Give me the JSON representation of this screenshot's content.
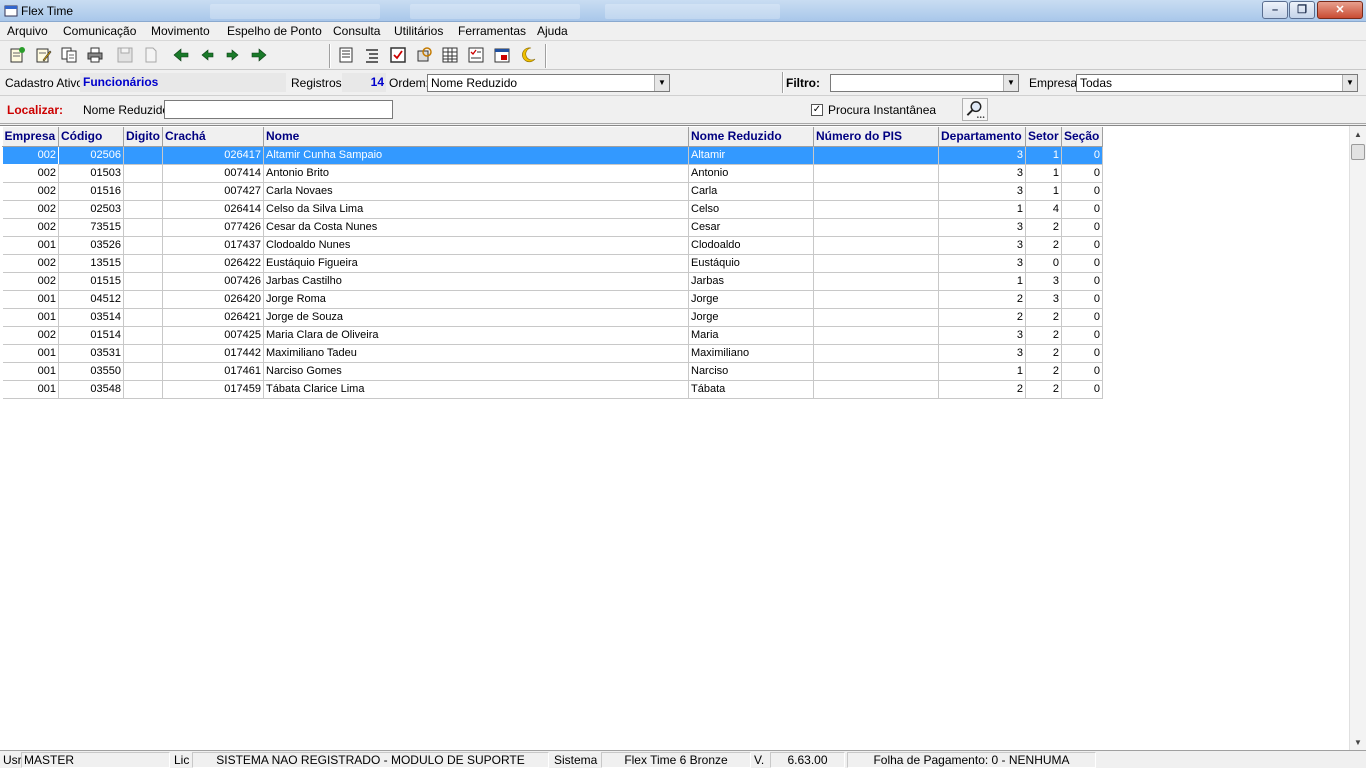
{
  "window": {
    "title": "Flex Time"
  },
  "menu": [
    "Arquivo",
    "Comunicação",
    "Movimento",
    "Espelho de Ponto",
    "Consulta",
    "Utilitários",
    "Ferramentas",
    "Ajuda"
  ],
  "toolbar_icons": [
    "new-record-icon",
    "edit-record-icon",
    "copy-record-icon",
    "print-icon",
    "save-icon",
    "delete-icon",
    "first-record-icon",
    "previous-record-icon",
    "next-record-icon",
    "last-record-icon",
    "report-icon",
    "list-icon",
    "checklist-icon",
    "refresh-icon",
    "table-icon",
    "checkbox-list-icon",
    "calendar-icon",
    "moon-icon"
  ],
  "info": {
    "cadastro_label": "Cadastro Ativo:",
    "cadastro_value": "Funcionários",
    "registros_label": "Registros:",
    "registros_value": "14",
    "ordem_label": "Ordem:",
    "ordem_value": "Nome Reduzido",
    "filtro_label": "Filtro:",
    "filtro_value": "",
    "empresa_label": "Empresa:",
    "empresa_value": "Todas"
  },
  "search": {
    "localizar_label": "Localizar:",
    "field_label": "Nome Reduzido",
    "field_value": "",
    "instant_label": "Procura Instantânea",
    "instant_checked": "✓"
  },
  "grid": {
    "columns": [
      "Empresa",
      "Código",
      "Digito",
      "Crachá",
      "Nome",
      "Nome Reduzido",
      "Número do PIS",
      "Departamento",
      "Setor",
      "Seção"
    ],
    "rows": [
      [
        "002",
        "02506",
        "",
        "026417",
        "Altamir Cunha Sampaio",
        "Altamir",
        "",
        "3",
        "1",
        "0"
      ],
      [
        "002",
        "01503",
        "",
        "007414",
        "Antonio Brito",
        "Antonio",
        "",
        "3",
        "1",
        "0"
      ],
      [
        "002",
        "01516",
        "",
        "007427",
        "Carla Novaes",
        "Carla",
        "",
        "3",
        "1",
        "0"
      ],
      [
        "002",
        "02503",
        "",
        "026414",
        "Celso da Silva Lima",
        "Celso",
        "",
        "1",
        "4",
        "0"
      ],
      [
        "002",
        "73515",
        "",
        "077426",
        "Cesar da Costa Nunes",
        "Cesar",
        "",
        "3",
        "2",
        "0"
      ],
      [
        "001",
        "03526",
        "",
        "017437",
        "Clodoaldo Nunes",
        "Clodoaldo",
        "",
        "3",
        "2",
        "0"
      ],
      [
        "002",
        "13515",
        "",
        "026422",
        "Eustáquio Figueira",
        "Eustáquio",
        "",
        "3",
        "0",
        "0"
      ],
      [
        "002",
        "01515",
        "",
        "007426",
        "Jarbas Castilho",
        "Jarbas",
        "",
        "1",
        "3",
        "0"
      ],
      [
        "001",
        "04512",
        "",
        "026420",
        "Jorge Roma",
        "Jorge",
        "",
        "2",
        "3",
        "0"
      ],
      [
        "001",
        "03514",
        "",
        "026421",
        "Jorge de Souza",
        "Jorge",
        "",
        "2",
        "2",
        "0"
      ],
      [
        "002",
        "01514",
        "",
        "007425",
        "Maria Clara de Oliveira",
        "Maria",
        "",
        "3",
        "2",
        "0"
      ],
      [
        "001",
        "03531",
        "",
        "017442",
        "Maximiliano Tadeu",
        "Maximiliano",
        "",
        "3",
        "2",
        "0"
      ],
      [
        "001",
        "03550",
        "",
        "017461",
        "Narciso Gomes",
        "Narciso",
        "",
        "1",
        "2",
        "0"
      ],
      [
        "001",
        "03548",
        "",
        "017459",
        "Tábata Clarice Lima",
        "Tábata",
        "",
        "2",
        "2",
        "0"
      ]
    ]
  },
  "status": {
    "usr_label": "Usr",
    "usr_value": "MASTER",
    "lic_label": "Lic",
    "lic_value": "SISTEMA NAO REGISTRADO - MODULO DE SUPORTE",
    "sistema_label": "Sistema",
    "sistema_value": "Flex Time 6 Bronze",
    "v_label": "V.",
    "v_value": "6.63.00",
    "folha_value": "Folha de Pagamento: 0 - NENHUMA"
  },
  "colors": {
    "selection": "#3399ff",
    "header_text": "#000080",
    "localizar": "#cc0000",
    "cadastro": "#0000cc"
  }
}
